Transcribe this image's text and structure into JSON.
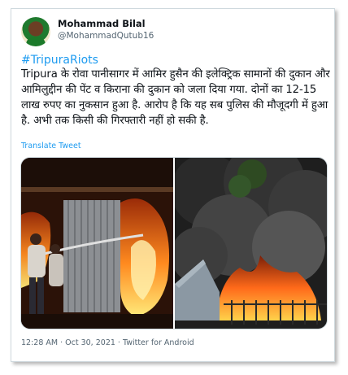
{
  "tweet": {
    "author_name": "Mohammad Bilal",
    "author_handle": "@MohammadQutub16",
    "hashtag": "#TripuraRiots",
    "body": "Tripura के रोवा पानीसागर में आमिर हुसैन की इलेक्ट्रिक सामानों की दुकान और आमिलुद्दीन की पेंट व किराना की दुकान को जला दिया गया. दोनों का 12-15 लाख रुपए का नुकसान हुआ है. आरोप है कि यह सब पुलिस की मौजूदगी में हुआ है. अभी तक किसी की गिरफ्तारी नहीं हो सकी है.",
    "translate_label": "Translate Tweet",
    "timestamp": "12:28 AM · Oct 30, 2021 · Twitter for Android"
  },
  "colors": {
    "link": "#1d9bf0",
    "text": "#0f1419",
    "muted": "#536471",
    "border": "#cfd9de"
  },
  "media": [
    {
      "icon": "burning-shop-photo"
    },
    {
      "icon": "smoke-fire-photo"
    }
  ]
}
